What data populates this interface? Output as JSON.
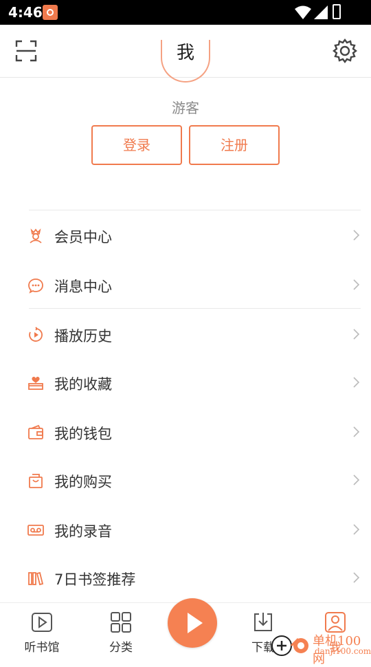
{
  "status_bar": {
    "time": "4:46"
  },
  "header": {
    "title": "我"
  },
  "profile": {
    "guest_label": "游客",
    "login_label": "登录",
    "register_label": "注册"
  },
  "menu": {
    "items": [
      {
        "label": "会员中心",
        "icon": "vip-crown-icon"
      },
      {
        "label": "消息中心",
        "icon": "message-bubble-icon"
      },
      {
        "label": "播放历史",
        "icon": "play-history-icon"
      },
      {
        "label": "我的收藏",
        "icon": "favorite-heart-icon"
      },
      {
        "label": "我的钱包",
        "icon": "wallet-icon"
      },
      {
        "label": "我的购买",
        "icon": "shopping-bag-icon"
      },
      {
        "label": "我的录音",
        "icon": "recording-tape-icon"
      },
      {
        "label": "7日书签推荐",
        "icon": "books-icon"
      }
    ]
  },
  "bottom_nav": {
    "tabs": [
      {
        "label": "听书馆",
        "icon": "play-square-icon"
      },
      {
        "label": "分类",
        "icon": "grid-icon"
      },
      {
        "label": "下载",
        "icon": "download-icon"
      },
      {
        "label": "我",
        "icon": "user-icon",
        "active": true
      }
    ]
  },
  "watermark": {
    "text": "单机100网",
    "url_text": "danji100.com"
  },
  "colors": {
    "accent": "#f07a4d",
    "text": "#333333",
    "muted": "#8a8a8a",
    "divider": "#e8e8e8"
  }
}
